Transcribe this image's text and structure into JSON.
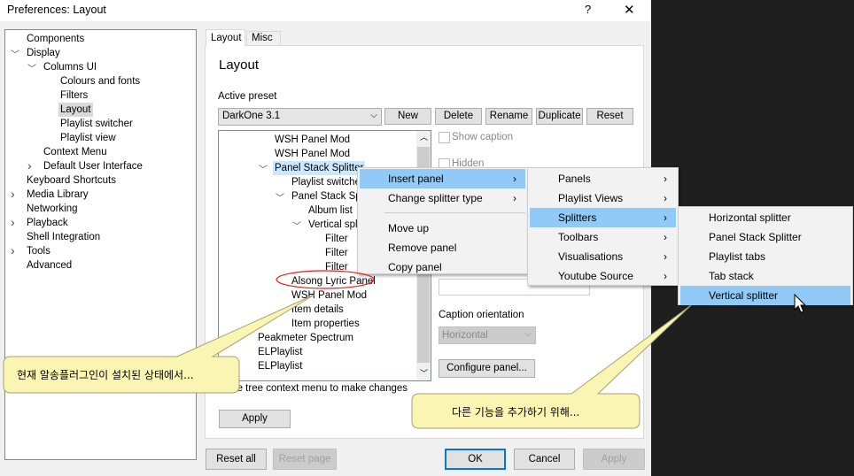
{
  "window": {
    "title": "Preferences: Layout",
    "help": "?",
    "close": "✕"
  },
  "nav_tree": [
    {
      "label": "Components",
      "indent": 0,
      "exp": ""
    },
    {
      "label": "Display",
      "indent": 0,
      "exp": "open"
    },
    {
      "label": "Columns UI",
      "indent": 1,
      "exp": "open"
    },
    {
      "label": "Colours and fonts",
      "indent": 2,
      "exp": ""
    },
    {
      "label": "Filters",
      "indent": 2,
      "exp": ""
    },
    {
      "label": "Layout",
      "indent": 2,
      "exp": "",
      "selected": true
    },
    {
      "label": "Playlist switcher",
      "indent": 2,
      "exp": ""
    },
    {
      "label": "Playlist view",
      "indent": 2,
      "exp": ""
    },
    {
      "label": "Context Menu",
      "indent": 1,
      "exp": ""
    },
    {
      "label": "Default User Interface",
      "indent": 1,
      "exp": "closed"
    },
    {
      "label": "Keyboard Shortcuts",
      "indent": 0,
      "exp": ""
    },
    {
      "label": "Media Library",
      "indent": 0,
      "exp": "closed"
    },
    {
      "label": "Networking",
      "indent": 0,
      "exp": ""
    },
    {
      "label": "Playback",
      "indent": 0,
      "exp": "closed"
    },
    {
      "label": "Shell Integration",
      "indent": 0,
      "exp": ""
    },
    {
      "label": "Tools",
      "indent": 0,
      "exp": "closed"
    },
    {
      "label": "Advanced",
      "indent": 0,
      "exp": ""
    }
  ],
  "tabs": [
    {
      "label": "Layout",
      "active": true
    },
    {
      "label": "Misc"
    }
  ],
  "page": {
    "heading": "Layout",
    "active_preset_label": "Active preset",
    "preset_value": "DarkOne 3.1",
    "preset_buttons": [
      "New",
      "Delete",
      "Rename",
      "Duplicate",
      "Reset"
    ],
    "panel_tree": [
      {
        "label": "WSH Panel Mod",
        "indent": 1,
        "exp": ""
      },
      {
        "label": "WSH Panel Mod",
        "indent": 1,
        "exp": ""
      },
      {
        "label": "Panel Stack Splitter",
        "indent": 1,
        "exp": "open",
        "selected": true
      },
      {
        "label": "Playlist switcher",
        "indent": 2,
        "exp": ""
      },
      {
        "label": "Panel Stack Splitter",
        "indent": 2,
        "exp": "open"
      },
      {
        "label": "Album list",
        "indent": 3,
        "exp": ""
      },
      {
        "label": "Vertical splitter",
        "indent": 3,
        "exp": "open"
      },
      {
        "label": "Filter",
        "indent": 4,
        "exp": ""
      },
      {
        "label": "Filter",
        "indent": 4,
        "exp": ""
      },
      {
        "label": "Filter",
        "indent": 4,
        "exp": ""
      },
      {
        "label": "Alsong Lyric Panel",
        "indent": 2,
        "exp": ""
      },
      {
        "label": "WSH Panel Mod",
        "indent": 2,
        "exp": ""
      },
      {
        "label": "Item details",
        "indent": 2,
        "exp": ""
      },
      {
        "label": "Item properties",
        "indent": 2,
        "exp": ""
      },
      {
        "label": "Peakmeter Spectrum",
        "indent": 0,
        "exp": ""
      },
      {
        "label": "ELPlaylist",
        "indent": 0,
        "exp": ""
      },
      {
        "label": "ELPlaylist",
        "indent": 0,
        "exp": ""
      }
    ],
    "show_caption": "Show caption",
    "hidden": "Hidden",
    "caption_orientation_label": "Caption orientation",
    "caption_orientation_value": "Horizontal",
    "configure_panel": "Configure panel...",
    "hint": "the tree context menu to make changes",
    "apply": "Apply"
  },
  "footer": {
    "reset_all": "Reset all",
    "reset_page": "Reset page",
    "ok": "OK",
    "cancel": "Cancel",
    "apply": "Apply"
  },
  "context_menu": {
    "items": [
      "Insert panel",
      "Change splitter type",
      "Move up",
      "Remove panel",
      "Copy panel"
    ]
  },
  "submenu_insert": [
    "Panels",
    "Playlist Views",
    "Splitters",
    "Toolbars",
    "Visualisations",
    "Youtube Source"
  ],
  "submenu_splitters": [
    "Horizontal splitter",
    "Panel Stack Splitter",
    "Playlist tabs",
    "Tab stack",
    "Vertical splitter"
  ],
  "callouts": [
    "현재 알송플러그인이 설치된 상태에서...",
    "다른 기능을 추가하기 위해..."
  ],
  "colors": {
    "highlight": "#91c9f7",
    "callout": "#fbf5b4",
    "annotation": "#e02020"
  }
}
